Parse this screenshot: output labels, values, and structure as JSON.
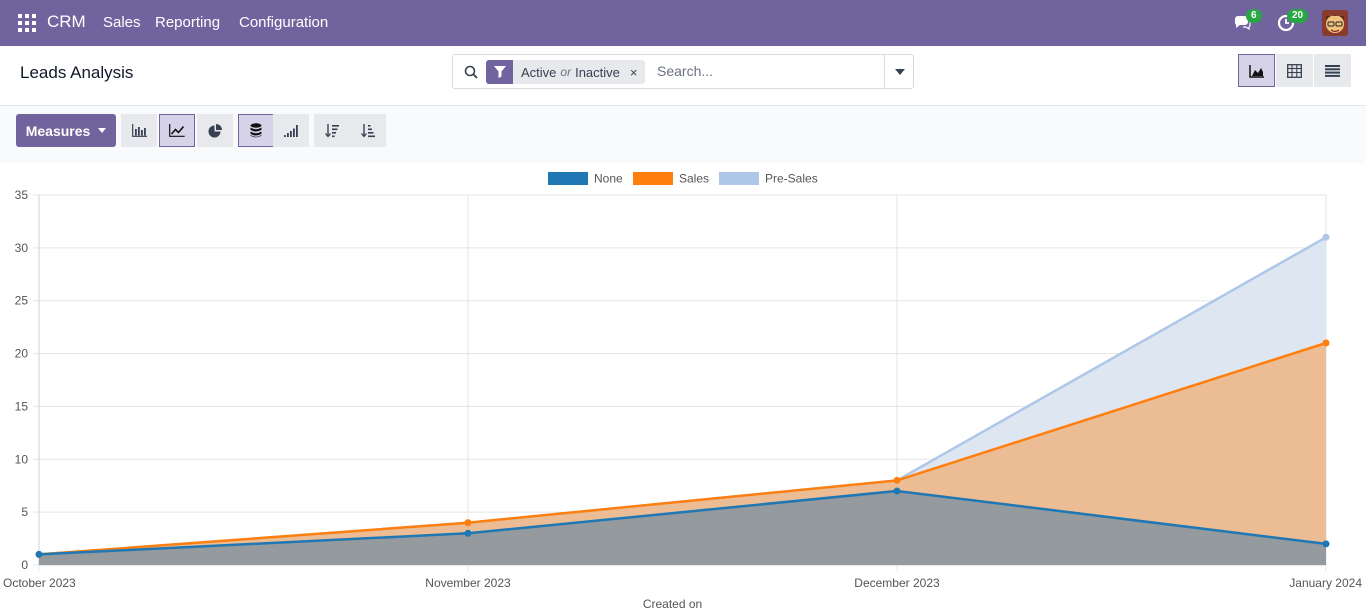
{
  "navbar": {
    "brand": "CRM",
    "menu": [
      "Sales",
      "Reporting",
      "Configuration"
    ],
    "messages_count": "6",
    "activities_count": "20",
    "color": "#71639e"
  },
  "control_panel": {
    "title": "Leads Analysis",
    "facet": {
      "value1": "Active",
      "separator": "or",
      "value2": "Inactive"
    },
    "search_placeholder": "Search..."
  },
  "toolbar": {
    "measures_label": "Measures"
  },
  "chart_data": {
    "type": "area",
    "stacked": true,
    "categories": [
      "October 2023",
      "November 2023",
      "December 2023",
      "January 2024"
    ],
    "xlabel": "Created on",
    "ylabel": "",
    "ylim": [
      0,
      35
    ],
    "yticks": [
      0,
      5,
      10,
      15,
      20,
      25,
      30,
      35
    ],
    "grid": true,
    "legend_position": "top-center",
    "series": [
      {
        "name": "None",
        "values": [
          1,
          3,
          7,
          2
        ],
        "color": "#1f77b4"
      },
      {
        "name": "Sales",
        "values": [
          0,
          1,
          1,
          19
        ],
        "color": "#ff7f0e"
      },
      {
        "name": "Pre-Sales",
        "values": [
          0,
          0,
          0,
          10
        ],
        "color": "#aec7e8"
      }
    ]
  }
}
